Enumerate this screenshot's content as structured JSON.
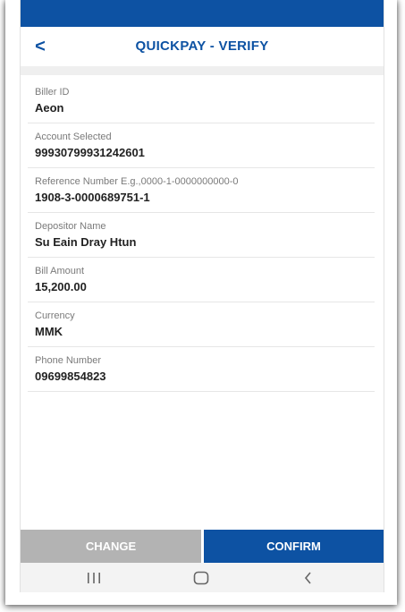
{
  "header": {
    "back_label": "<",
    "title": "QUICKPAY - VERIFY"
  },
  "fields": [
    {
      "label": "Biller ID",
      "value": "Aeon"
    },
    {
      "label": "Account Selected",
      "value": "99930799931242601"
    },
    {
      "label": "Reference Number E.g.,0000-1-0000000000-0",
      "value": "1908-3-0000689751-1"
    },
    {
      "label": "Depositor Name",
      "value": "Su Eain Dray Htun"
    },
    {
      "label": "Bill Amount",
      "value": "15,200.00"
    },
    {
      "label": "Currency",
      "value": "MMK"
    },
    {
      "label": "Phone Number",
      "value": "09699854823"
    }
  ],
  "actions": {
    "change_label": "CHANGE",
    "confirm_label": "CONFIRM"
  },
  "navbar": {
    "recent_icon": "recent-apps-icon",
    "home_icon": "home-icon",
    "back_icon": "back-nav-icon"
  },
  "colors": {
    "primary": "#0d52a3",
    "change_button": "#b3b3b3"
  }
}
